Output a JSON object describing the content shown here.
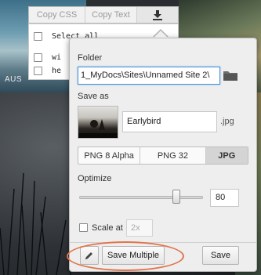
{
  "toolbar": {
    "copy_css": "Copy CSS",
    "copy_text": "Copy Text",
    "download_icon": "download-icon"
  },
  "layers": {
    "rows": [
      "Select all",
      "wi",
      "he"
    ]
  },
  "canvas": {
    "aus_label": "AUS"
  },
  "export": {
    "folder_label": "Folder",
    "folder_path": "1_MyDocs\\Sites\\Unnamed Site 2\\",
    "save_as_label": "Save as",
    "file_name": "Earlybird",
    "extension": ".jpg",
    "formats": [
      "PNG 8 Alpha",
      "PNG 32",
      "JPG"
    ],
    "selected_format": "JPG",
    "optimize_label": "Optimize",
    "optimize_value": "80",
    "optimize_level": 80,
    "scale_label": "Scale at",
    "scale_value": "2x",
    "save_multiple_label": "Save Multiple",
    "save_label": "Save"
  },
  "colors": {
    "accent_focus": "#4a90d9",
    "highlight_ring": "#e2744a"
  }
}
